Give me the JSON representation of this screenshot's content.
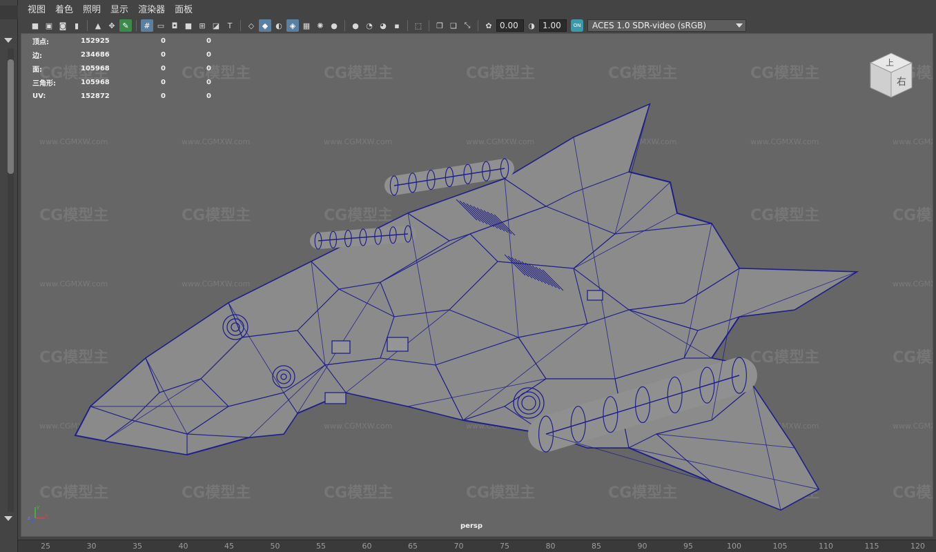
{
  "menu": [
    "视图",
    "着色",
    "照明",
    "显示",
    "渲染器",
    "面板"
  ],
  "toolbar": {
    "exposure": "0.00",
    "gamma": "1.00",
    "aces_badge": "ON",
    "color_space": "ACES 1.0 SDR-video (sRGB)"
  },
  "hud": {
    "rows": [
      {
        "label": "顶点:",
        "v1": "152925",
        "v2": "0",
        "v3": "0"
      },
      {
        "label": "边:",
        "v1": "234686",
        "v2": "0",
        "v3": "0"
      },
      {
        "label": "面:",
        "v1": "105968",
        "v2": "0",
        "v3": "0"
      },
      {
        "label": "三角形:",
        "v1": "105968",
        "v2": "0",
        "v3": "0"
      },
      {
        "label": "UV:",
        "v1": "152872",
        "v2": "0",
        "v3": "0"
      }
    ]
  },
  "viewcube": {
    "top": "上",
    "right": "右"
  },
  "camera_label": "persp",
  "axis": {
    "x": "x",
    "y": "y",
    "z": "z"
  },
  "watermark": {
    "logo": "CG模型主",
    "url": "www.CGMXW.com"
  },
  "ruler": [
    "25",
    "30",
    "35",
    "40",
    "45",
    "50",
    "55",
    "60",
    "65",
    "70",
    "75",
    "80",
    "85",
    "90",
    "95",
    "100",
    "105",
    "110",
    "115",
    "120"
  ],
  "colors": {
    "wireframe": "#1f1f8a",
    "viewport_bg": "#666666",
    "highlight": "#5a7fa0"
  }
}
